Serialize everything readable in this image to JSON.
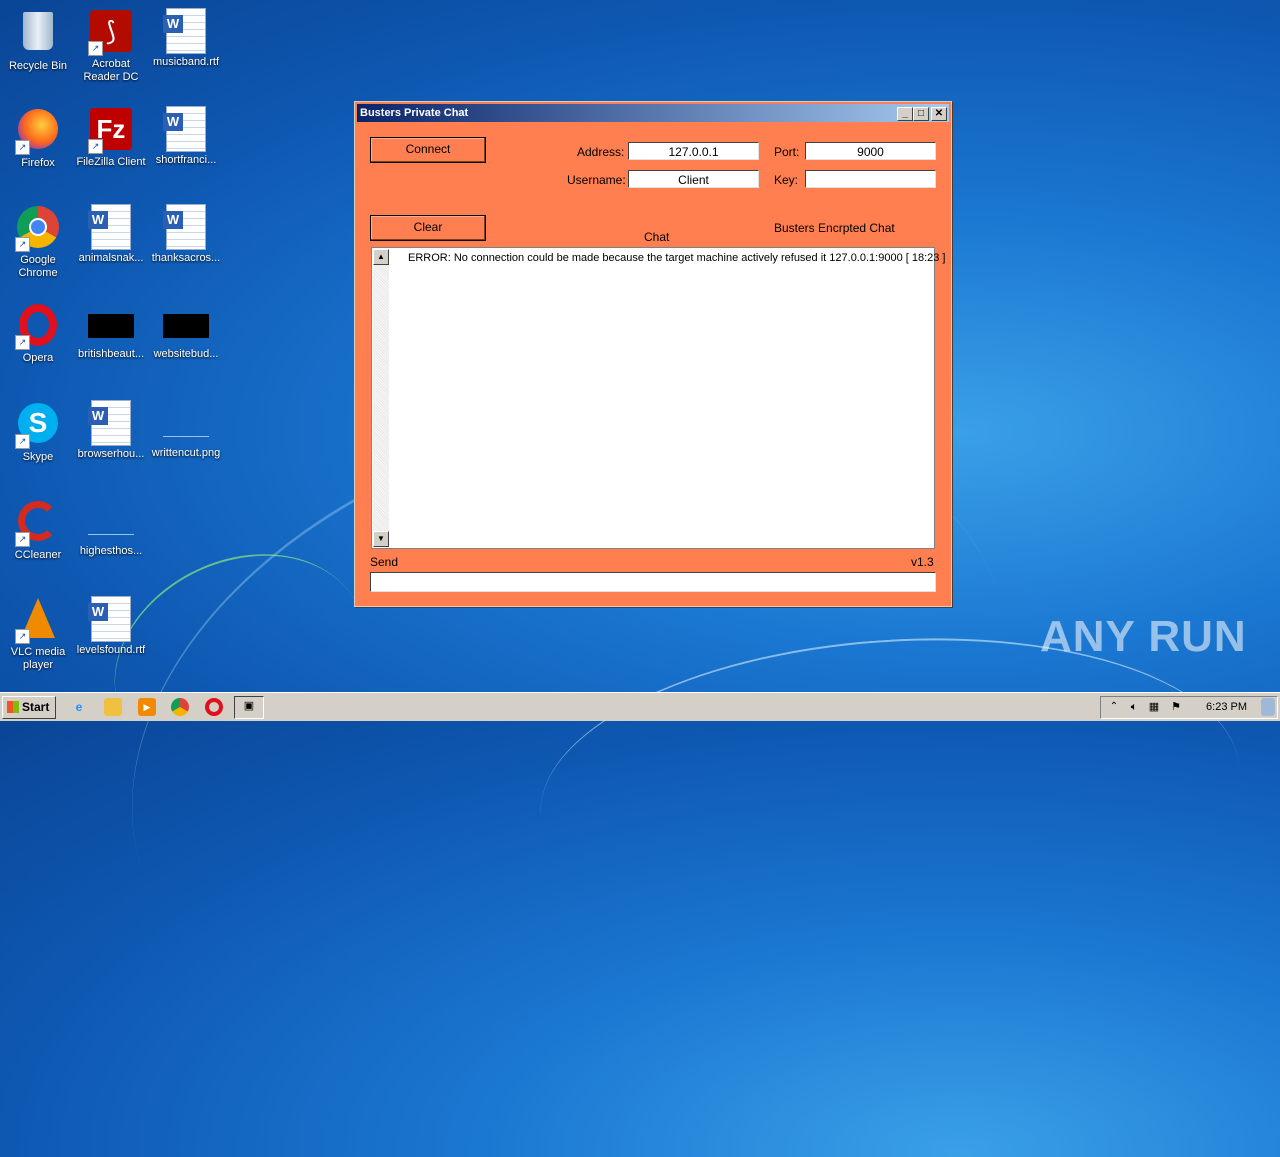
{
  "desktop": {
    "icons": [
      {
        "label": "Recycle Bin"
      },
      {
        "label": "Acrobat Reader DC"
      },
      {
        "label": "musicband.rtf"
      },
      {
        "label": "Firefox"
      },
      {
        "label": "FileZilla Client"
      },
      {
        "label": "shortfranci..."
      },
      {
        "label": "Google Chrome"
      },
      {
        "label": "animalsnak..."
      },
      {
        "label": "thanksacros..."
      },
      {
        "label": "Opera"
      },
      {
        "label": "britishbeaut..."
      },
      {
        "label": "websitebud..."
      },
      {
        "label": "Skype"
      },
      {
        "label": "browserhou..."
      },
      {
        "label": "writtencut.png"
      },
      {
        "label": "CCleaner"
      },
      {
        "label": "highesthos..."
      },
      {
        "label": "VLC media player"
      },
      {
        "label": "levelsfound.rtf"
      }
    ],
    "watermark": "ANY RUN"
  },
  "window": {
    "title": "Busters Private Chat",
    "connect_label": "Connect",
    "address_label": "Address:",
    "address_value": "127.0.0.1",
    "port_label": "Port:",
    "port_value": "9000",
    "username_label": "Username:",
    "username_value": "Client",
    "key_label": "Key:",
    "key_value": "",
    "clear_label": "Clear",
    "chat_label": "Chat",
    "subtitle": "Busters Encrpted Chat",
    "chat_lines": [
      "ERROR: No connection could be made because the target machine actively refused it 127.0.0.1:9000 [ 18:23 ]"
    ],
    "send_label": "Send",
    "version": "v1.3",
    "send_value": ""
  },
  "taskbar": {
    "start_label": "Start",
    "clock": "6:23 PM"
  }
}
